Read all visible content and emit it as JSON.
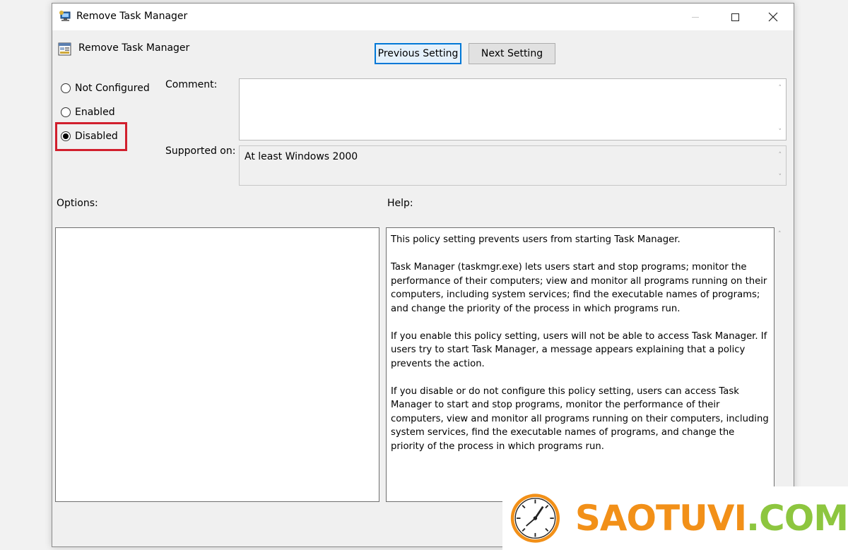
{
  "window": {
    "title": "Remove Task Manager"
  },
  "setting": {
    "name": "Remove Task Manager"
  },
  "nav": {
    "previous_label": "Previous Setting",
    "next_label": "Next Setting"
  },
  "state": {
    "options": [
      "Not Configured",
      "Enabled",
      "Disabled"
    ],
    "selected": "Disabled"
  },
  "labels": {
    "comment": "Comment:",
    "supported_on": "Supported on:",
    "options": "Options:",
    "help": "Help:"
  },
  "supported_on_value": "At least Windows 2000",
  "comment_value": "",
  "help_text": [
    "This policy setting prevents users from starting Task Manager.",
    "Task Manager (taskmgr.exe) lets users start and stop programs; monitor the performance of their computers; view and monitor all programs running on their computers, including system services; find the executable names of programs; and change the priority of the process in which programs run.",
    "If you enable this policy setting, users will not be able to access Task Manager. If users try to start Task Manager, a message appears explaining that a policy prevents the action.",
    "If you disable or do not configure this policy setting, users can access Task Manager to  start and stop programs, monitor the performance of their computers, view and monitor all programs running on their computers, including system services, find the executable names of programs, and change the priority of the process in which programs run."
  ],
  "watermark": {
    "part1": "SAOTUVI",
    "part2": ".COM",
    "colors": {
      "orange": "#f29018",
      "green": "#8dc63f"
    }
  },
  "colors": {
    "highlight_box": "#d11f2d",
    "focus_button_border": "#0078d7"
  }
}
